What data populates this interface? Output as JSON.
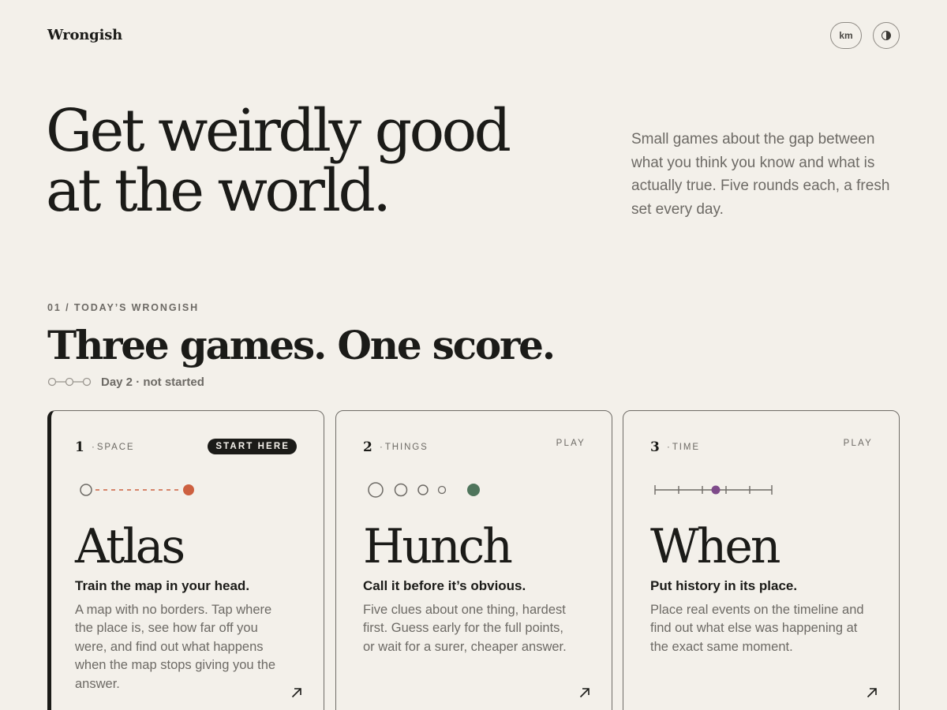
{
  "header": {
    "brand": "Wrongish",
    "unit_button": "km",
    "theme_icon": "half-circle-contrast-icon"
  },
  "hero": {
    "title_line_1": "Get weirdly good",
    "title_line_2": "at the world.",
    "description": "Small games about the gap between what you think you know and what is actually true. Five rounds each, a fresh set every day."
  },
  "section": {
    "eyebrow": "01 / TODAY’S WRONGISH",
    "title": "Three games. One score.",
    "progress_icon": "three-step-progress-icon",
    "progress_completed": 0,
    "progress_total": 3,
    "status": "Day 2 · not started"
  },
  "colors": {
    "background": "#f3f0ea",
    "ink": "#1b1b18",
    "muted": "#6d6a65",
    "atlas_accent": "#cd6040",
    "hunch_accent": "#4f755c",
    "when_accent": "#7e4a8a"
  },
  "cards": [
    {
      "number": "1",
      "category": "SPACE",
      "action": "START HERE",
      "icon": "distance-line-icon",
      "name": "Atlas",
      "tagline": "Train the map in your head.",
      "description": "A map with no borders. Tap where the place is, see how far off you were, and find out what happens when the map stops giving you the answer.",
      "arrow_icon": "arrow-up-right-icon"
    },
    {
      "number": "2",
      "category": "THINGS",
      "action": "PLAY",
      "icon": "shrinking-circles-icon",
      "name": "Hunch",
      "tagline": "Call it before it’s obvious.",
      "description": "Five clues about one thing, hardest first. Guess early for the full points, or wait for a surer, cheaper answer.",
      "arrow_icon": "arrow-up-right-icon"
    },
    {
      "number": "3",
      "category": "TIME",
      "action": "PLAY",
      "icon": "timeline-ticks-icon",
      "name": "When",
      "tagline": "Put history in its place.",
      "description": "Place real events on the timeline and find out what else was happening at the exact same moment.",
      "arrow_icon": "arrow-up-right-icon"
    }
  ]
}
